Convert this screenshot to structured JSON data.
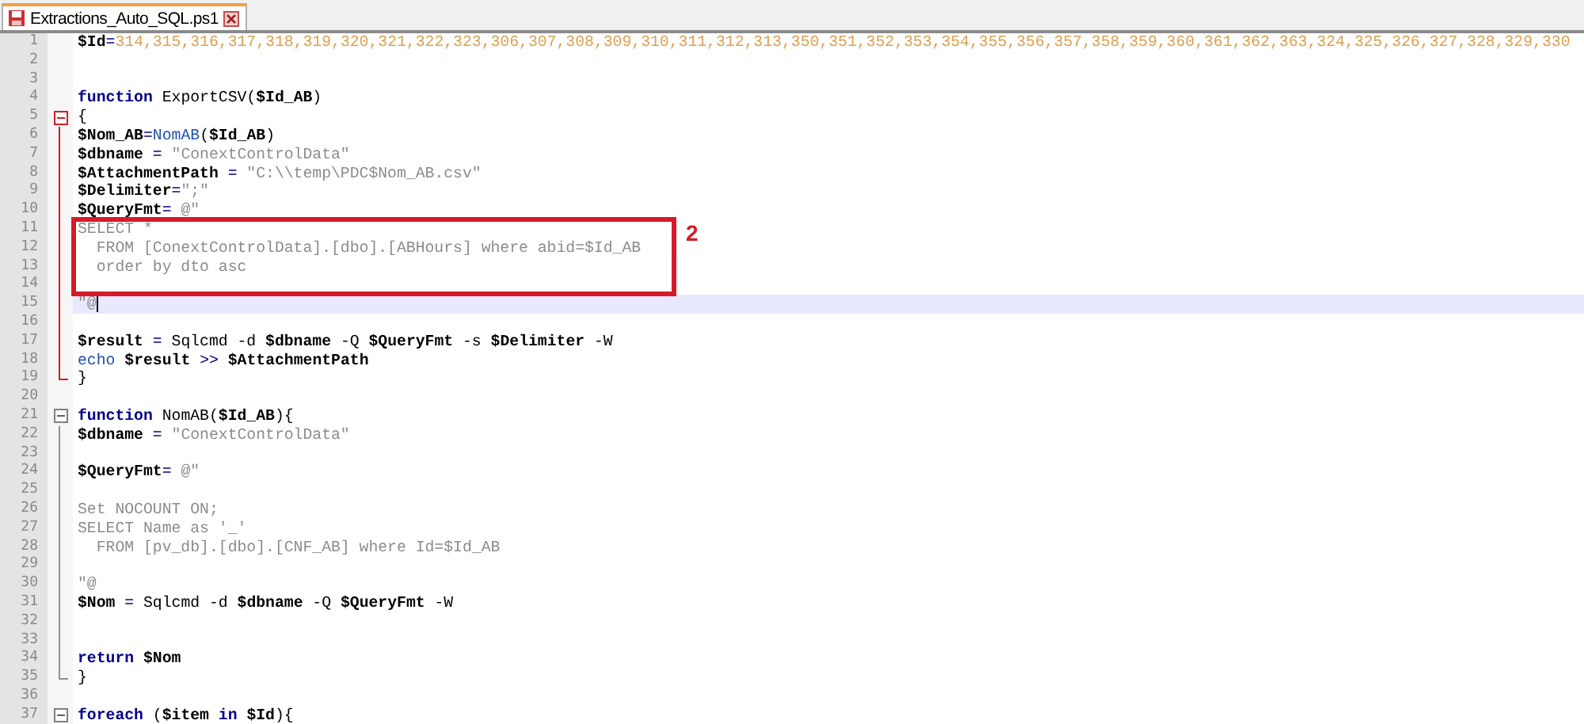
{
  "tab": {
    "title": "Extractions_Auto_SQL.ps1",
    "selected": true,
    "modified": true
  },
  "annotation": {
    "label": "2"
  },
  "lines": [
    {
      "number": "1",
      "segments": [
        {
          "kind": "var",
          "text": "$Id"
        },
        {
          "kind": "op",
          "text": "="
        },
        {
          "kind": "num",
          "text": "314,315,316,317,318,319,320,321,322,323,306,307,308,309,310,311,312,313,350,351,352,353,354,355,356,357,358,359,360,361,362,363,324,325,326,327,328,329,330"
        }
      ]
    },
    {
      "number": "2"
    },
    {
      "number": "3"
    },
    {
      "number": "4",
      "segments": [
        {
          "kind": "kw",
          "text": "function"
        },
        {
          "kind": "plain",
          "text": " ExportCSV("
        },
        {
          "kind": "var",
          "text": "$Id_AB"
        },
        {
          "kind": "plain",
          "text": ")"
        }
      ]
    },
    {
      "number": "5",
      "expanded": true,
      "segments": [
        {
          "kind": "plain",
          "text": "{"
        }
      ]
    },
    {
      "number": "6",
      "segments": [
        {
          "kind": "var",
          "text": "$Nom_AB"
        },
        {
          "kind": "op",
          "text": "="
        },
        {
          "kind": "cmd",
          "text": "NomAB"
        },
        {
          "kind": "plain",
          "text": "("
        },
        {
          "kind": "var",
          "text": "$Id_AB"
        },
        {
          "kind": "plain",
          "text": ")"
        }
      ]
    },
    {
      "number": "7",
      "segments": [
        {
          "kind": "var",
          "text": "$dbname"
        },
        {
          "kind": "op",
          "text": " = "
        },
        {
          "kind": "str",
          "text": "\"ConextControlData\""
        }
      ]
    },
    {
      "number": "8",
      "segments": [
        {
          "kind": "var",
          "text": "$AttachmentPath"
        },
        {
          "kind": "op",
          "text": " = "
        },
        {
          "kind": "str",
          "text": "\"C:\\\\temp\\PDC$Nom_AB.csv\""
        }
      ]
    },
    {
      "number": "9",
      "segments": [
        {
          "kind": "var",
          "text": "$Delimiter"
        },
        {
          "kind": "op",
          "text": "="
        },
        {
          "kind": "str",
          "text": "\";\""
        }
      ]
    },
    {
      "number": "10",
      "segments": [
        {
          "kind": "var",
          "text": "$QueryFmt"
        },
        {
          "kind": "op",
          "text": "= "
        },
        {
          "kind": "str",
          "text": "@\""
        }
      ]
    },
    {
      "number": "11",
      "annotated": true,
      "segments": [
        {
          "kind": "str",
          "text": "SELECT *"
        }
      ]
    },
    {
      "number": "12",
      "annotated": true,
      "segments": [
        {
          "kind": "str",
          "text": "  FROM [ConextControlData].[dbo].[ABHours] where abid=$Id_AB"
        }
      ]
    },
    {
      "number": "13",
      "annotated": true,
      "segments": [
        {
          "kind": "str",
          "text": "  order by dto asc"
        }
      ]
    },
    {
      "number": "14",
      "annotated": true
    },
    {
      "number": "15",
      "selected": true,
      "segments": [
        {
          "kind": "str",
          "text": "\"@"
        }
      ]
    },
    {
      "number": "16"
    },
    {
      "number": "17",
      "segments": [
        {
          "kind": "var",
          "text": "$result"
        },
        {
          "kind": "op",
          "text": " = "
        },
        {
          "kind": "plain",
          "text": "Sqlcmd -d "
        },
        {
          "kind": "var",
          "text": "$dbname"
        },
        {
          "kind": "plain",
          "text": " -Q "
        },
        {
          "kind": "var",
          "text": "$QueryFmt"
        },
        {
          "kind": "plain",
          "text": " -s "
        },
        {
          "kind": "var",
          "text": "$Delimiter"
        },
        {
          "kind": "plain",
          "text": " -W"
        }
      ]
    },
    {
      "number": "18",
      "segments": [
        {
          "kind": "cmd",
          "text": "echo"
        },
        {
          "kind": "var",
          "text": " $result"
        },
        {
          "kind": "op",
          "text": " >> "
        },
        {
          "kind": "var",
          "text": "$AttachmentPath"
        }
      ]
    },
    {
      "number": "19",
      "block_end": true,
      "segments": [
        {
          "kind": "plain",
          "text": "}"
        }
      ]
    },
    {
      "number": "20"
    },
    {
      "number": "21",
      "expanded": true,
      "segments": [
        {
          "kind": "kw",
          "text": "function"
        },
        {
          "kind": "plain",
          "text": " NomAB("
        },
        {
          "kind": "var",
          "text": "$Id_AB"
        },
        {
          "kind": "plain",
          "text": "){"
        }
      ]
    },
    {
      "number": "22",
      "segments": [
        {
          "kind": "var",
          "text": "$dbname"
        },
        {
          "kind": "op",
          "text": " = "
        },
        {
          "kind": "str",
          "text": "\"ConextControlData\""
        }
      ]
    },
    {
      "number": "23"
    },
    {
      "number": "24",
      "segments": [
        {
          "kind": "var",
          "text": "$QueryFmt"
        },
        {
          "kind": "op",
          "text": "= "
        },
        {
          "kind": "str",
          "text": "@\""
        }
      ]
    },
    {
      "number": "25"
    },
    {
      "number": "26",
      "segments": [
        {
          "kind": "str",
          "text": "Set NOCOUNT ON;"
        }
      ]
    },
    {
      "number": "27",
      "segments": [
        {
          "kind": "str",
          "text": "SELECT Name as '_'"
        }
      ]
    },
    {
      "number": "28",
      "segments": [
        {
          "kind": "str",
          "text": "  FROM [pv_db].[dbo].[CNF_AB] where Id=$Id_AB"
        }
      ]
    },
    {
      "number": "29"
    },
    {
      "number": "30",
      "segments": [
        {
          "kind": "str",
          "text": "\"@"
        }
      ]
    },
    {
      "number": "31",
      "segments": [
        {
          "kind": "var",
          "text": "$Nom"
        },
        {
          "kind": "op",
          "text": " = "
        },
        {
          "kind": "plain",
          "text": "Sqlcmd -d "
        },
        {
          "kind": "var",
          "text": "$dbname"
        },
        {
          "kind": "plain",
          "text": " -Q "
        },
        {
          "kind": "var",
          "text": "$QueryFmt"
        },
        {
          "kind": "plain",
          "text": " -W"
        }
      ]
    },
    {
      "number": "32"
    },
    {
      "number": "33"
    },
    {
      "number": "34",
      "segments": [
        {
          "kind": "kw",
          "text": "return"
        },
        {
          "kind": "var",
          "text": " $Nom"
        }
      ]
    },
    {
      "number": "35",
      "block_end": true,
      "segments": [
        {
          "kind": "plain",
          "text": "}"
        }
      ]
    },
    {
      "number": "36"
    },
    {
      "number": "37",
      "expanded": true,
      "segments": [
        {
          "kind": "kw",
          "text": "foreach"
        },
        {
          "kind": "plain",
          "text": " ("
        },
        {
          "kind": "var",
          "text": "$item"
        },
        {
          "kind": "kw",
          "text": " in"
        },
        {
          "kind": "var",
          "text": " $Id"
        },
        {
          "kind": "plain",
          "text": "){"
        }
      ]
    }
  ]
}
